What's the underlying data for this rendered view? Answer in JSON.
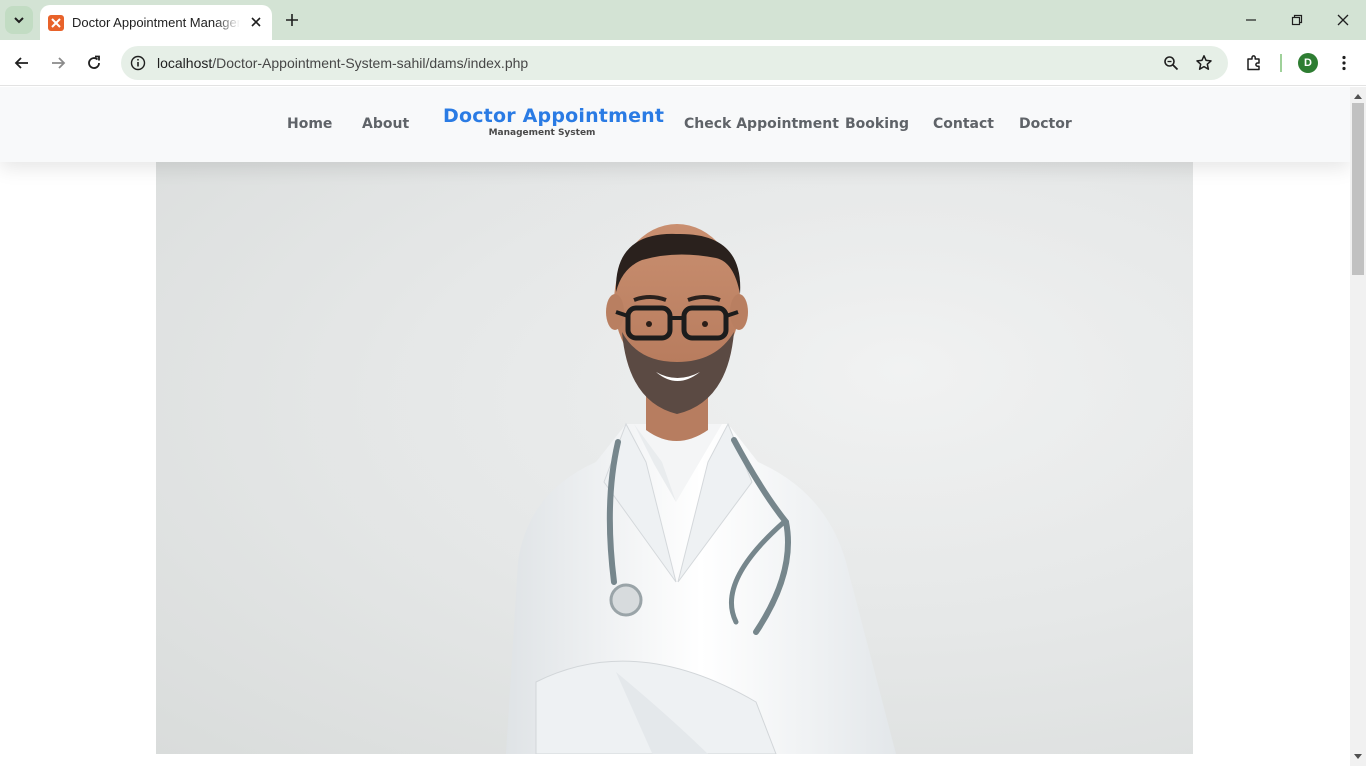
{
  "browser": {
    "tab": {
      "title": "Doctor Appointment Management System",
      "favicon": "xampp-favicon-icon"
    },
    "new_tab_label": "+",
    "address_bar": {
      "host": "localhost",
      "path": "/Doctor-Appointment-System-sahil/dams/index.php"
    },
    "profile_initial": "D",
    "colors": {
      "tabstrip": "#d3e3d4",
      "omnibox": "#e6efe7",
      "profile": "#2e7d32"
    }
  },
  "site": {
    "nav": {
      "home": "Home",
      "about": "About",
      "check_appointment": "Check Appointment",
      "booking": "Booking",
      "contact": "Contact",
      "doctor": "Doctor"
    },
    "brand": {
      "title": "Doctor Appointment",
      "subtitle": "Management System"
    },
    "colors": {
      "brand": "#2a7be4",
      "nav_text": "#5f6368",
      "header_bg": "#f8f9fa"
    },
    "hero": {
      "image": "smiling-doctor-photo",
      "coat_color": "#ffffff",
      "background_color": "#e6e8e8"
    }
  }
}
